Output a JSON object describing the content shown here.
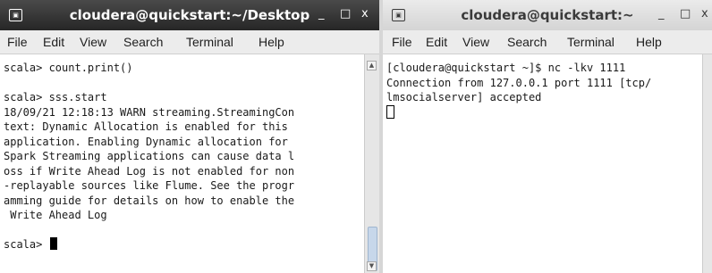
{
  "left_window": {
    "title": "cloudera@quickstart:~/Desktop",
    "icon_glyph": "▣",
    "controls": {
      "minimize": "_",
      "maximize": "□",
      "close": "x"
    },
    "menu": [
      "File",
      "Edit",
      "View",
      "Search",
      "Terminal",
      "Help"
    ],
    "lines": [
      "scala> count.print()",
      "",
      "scala> sss.start",
      "18/09/21 12:18:13 WARN streaming.StreamingCon",
      "text: Dynamic Allocation is enabled for this",
      "application. Enabling Dynamic allocation for",
      "Spark Streaming applications can cause data l",
      "oss if Write Ahead Log is not enabled for non",
      "-replayable sources like Flume. See the progr",
      "amming guide for details on how to enable the",
      " Write Ahead Log",
      ""
    ],
    "prompt": "scala> ",
    "scrollbar": {
      "up_glyph": "▲",
      "down_glyph": "▼",
      "thumb_glyph": "≡"
    }
  },
  "right_window": {
    "title": "cloudera@quickstart:~",
    "icon_glyph": "▣",
    "controls": {
      "minimize": "_",
      "maximize": "□",
      "close": "x"
    },
    "menu": [
      "File",
      "Edit",
      "View",
      "Search",
      "Terminal",
      "Help"
    ],
    "lines": [
      "[cloudera@quickstart ~]$ nc -lkv 1111",
      "Connection from 127.0.0.1 port 1111 [tcp/",
      "lmsocialserver] accepted"
    ]
  }
}
